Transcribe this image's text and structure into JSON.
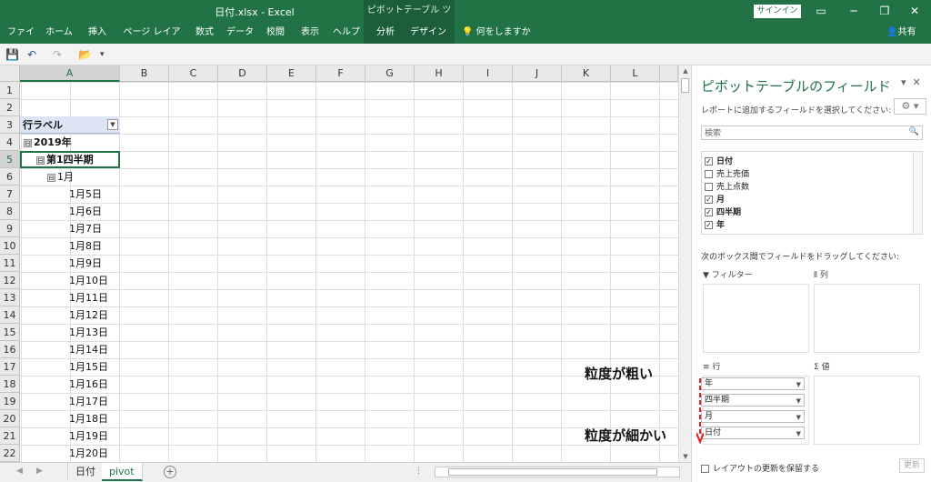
{
  "window": {
    "title": "日付.xlsx  -  Excel",
    "context_tab": "ピボットテーブル ツール",
    "signin": "サインイン",
    "restore_icon": "ribbon-display-icon",
    "minimize": "─",
    "maximize": "❐",
    "close": "✕"
  },
  "ribbon": {
    "tabs": [
      "ファイル",
      "ホーム",
      "挿入",
      "ページ レイアウト",
      "数式",
      "データ",
      "校閲",
      "表示",
      "ヘルプ",
      "分析",
      "デザイン"
    ],
    "tell_me": "何をしますか",
    "share": "共有"
  },
  "qat": {
    "save": "💾",
    "undo": "↶",
    "redo": "↷",
    "open": "📂",
    "more": "▾"
  },
  "sheet": {
    "columns": [
      "A",
      "B",
      "C",
      "D",
      "E",
      "F",
      "G",
      "H",
      "I",
      "J",
      "K",
      "L"
    ],
    "rows": [
      "1",
      "2",
      "3",
      "4",
      "5",
      "6",
      "7",
      "8",
      "9",
      "10",
      "11",
      "12",
      "13",
      "14",
      "15",
      "16",
      "17",
      "18",
      "19",
      "20",
      "21",
      "22"
    ],
    "a3": "行ラベル",
    "a4": "2019年",
    "a5": "第1四半期",
    "a6": "1月",
    "dates": [
      "1月5日",
      "1月6日",
      "1月7日",
      "1月8日",
      "1月9日",
      "1月10日",
      "1月11日",
      "1月12日",
      "1月13日",
      "1月14日",
      "1月15日",
      "1月16日",
      "1月17日",
      "1月18日",
      "1月19日",
      "1月20日"
    ],
    "minus": "⊟"
  },
  "sheet_tabs": [
    "日付",
    "pivot"
  ],
  "pivot_panel": {
    "title": "ピボットテーブルのフィールド",
    "close": "✕",
    "subtitle": "レポートに追加するフィールドを選択してください:",
    "search_placeholder": "検索",
    "fields": [
      {
        "label": "日付",
        "checked": "✓"
      },
      {
        "label": "売上売価",
        "checked": ""
      },
      {
        "label": "売上点数",
        "checked": ""
      },
      {
        "label": "月",
        "checked": "✓"
      },
      {
        "label": "四半期",
        "checked": "✓"
      },
      {
        "label": "年",
        "checked": "✓"
      }
    ],
    "drag_hint": "次のボックス間でフィールドをドラッグしてください:",
    "areas": {
      "filter": "フィルター",
      "columns": "列",
      "rows": "行",
      "values": "値"
    },
    "row_chips": [
      "年",
      "四半期",
      "月",
      "日付"
    ],
    "defer": "レイアウトの更新を保留する",
    "update": "更新"
  },
  "annotations": {
    "coarse": "粒度が粗い",
    "fine": "粒度が細かい"
  },
  "colors": {
    "excel_green": "#217346",
    "arrow_red": "#e02020"
  }
}
